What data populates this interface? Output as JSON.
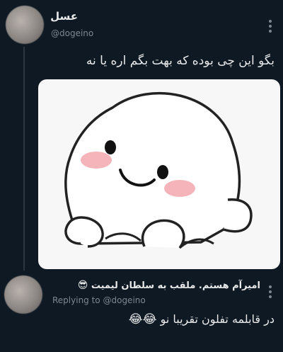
{
  "tweet1": {
    "name": "عسل",
    "handle": "@dogeino",
    "text": "بگو این چی بوده که بهت بگم اره یا نه",
    "media": {
      "description": "",
      "icon": "cute-blob-sticker"
    }
  },
  "tweet2": {
    "name": "امیرآم هستم. ملقب به سلطان لیمیت",
    "name_emoji": "😎",
    "replying_to_label": "Replying to",
    "replying_to_handle": "@dogeino",
    "text": "در قابلمه تفلون تقریبا نو",
    "text_emoji": "😂😂"
  },
  "colors": {
    "background": "#0f1923",
    "text": "#e7e9ea",
    "muted": "#7d8790",
    "blush": "#f3a7ad"
  }
}
